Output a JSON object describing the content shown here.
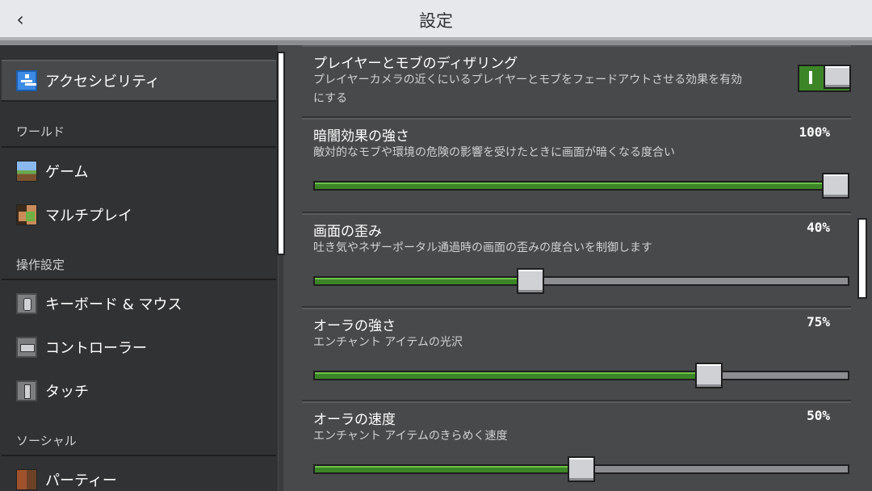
{
  "header": {
    "title": "設定",
    "back_glyph": "‹"
  },
  "sidebar": {
    "items": [
      {
        "label": "アクセシビリティ",
        "icon": "accessibility-icon",
        "selected": true
      },
      {
        "label": "ゲーム",
        "icon": "game-icon"
      },
      {
        "label": "マルチプレイ",
        "icon": "multiplayer-icon"
      },
      {
        "label": "キーボード & マウス",
        "icon": "keyboard-mouse-icon"
      },
      {
        "label": "コントローラー",
        "icon": "controller-icon"
      },
      {
        "label": "タッチ",
        "icon": "touch-icon"
      },
      {
        "label": "パーティー",
        "icon": "party-icon"
      }
    ],
    "sections": {
      "world": "ワールド",
      "controls": "操作設定",
      "social": "ソーシャル"
    }
  },
  "settings": [
    {
      "title": "プレイヤーとモブのディザリング",
      "description": "プレイヤーカメラの近くにいるプレイヤーとモブをフェードアウトさせる効果を有効にする",
      "type": "toggle",
      "on": true
    },
    {
      "title": "暗闇効果の強さ",
      "description": "敵対的なモブや環境の危険の影響を受けたときに画面が暗くなる度合い",
      "value": "100%",
      "fraction": 1.0
    },
    {
      "title": "画面の歪み",
      "description": "吐き気やネザーポータル通過時の画面の歪みの度合いを制御します",
      "value": "40%",
      "fraction": 0.4
    },
    {
      "title": "オーラの強さ",
      "description": "エンチャント アイテムの光沢",
      "value": "75%",
      "fraction": 0.75
    },
    {
      "title": "オーラの速度",
      "description": "エンチャント アイテムのきらめく速度",
      "value": "50%",
      "fraction": 0.5
    }
  ],
  "colors": {
    "accent_green": "#3c8527",
    "panel": "#48494a",
    "header": "#e6e8eb"
  }
}
